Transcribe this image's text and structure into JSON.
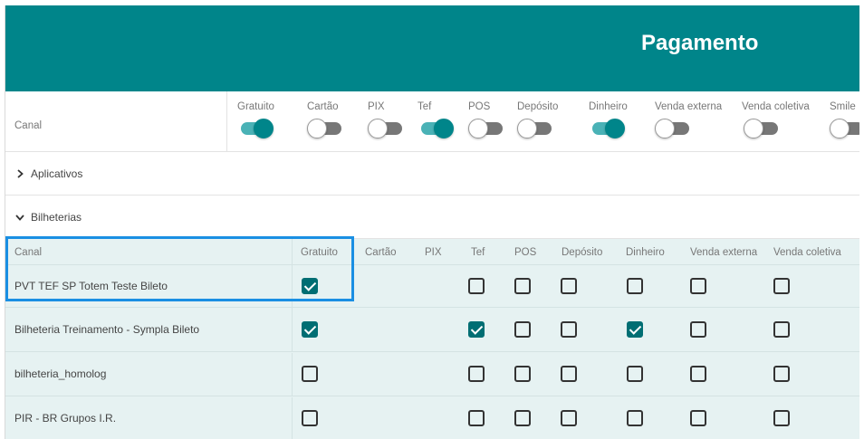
{
  "header": {
    "title": "Pagamento"
  },
  "toggle_header": {
    "canal_label": "Canal",
    "toggles": [
      {
        "label": "Gratuito",
        "on": true
      },
      {
        "label": "Cartão",
        "on": false
      },
      {
        "label": "PIX",
        "on": false
      },
      {
        "label": "Tef",
        "on": true
      },
      {
        "label": "POS",
        "on": false
      },
      {
        "label": "Depósito",
        "on": false
      },
      {
        "label": "Dinheiro",
        "on": true
      },
      {
        "label": "Venda externa",
        "on": false
      },
      {
        "label": "Venda coletiva",
        "on": false
      },
      {
        "label": "Smile",
        "on": false
      }
    ]
  },
  "groups": [
    {
      "label": "Aplicativos",
      "expanded": false,
      "icon": "chevron-right-icon"
    },
    {
      "label": "Bilheterias",
      "expanded": true,
      "icon": "chevron-down-icon"
    }
  ],
  "table": {
    "columns": [
      "Canal",
      "Gratuito",
      "Cartão",
      "PIX",
      "Tef",
      "POS",
      "Depósito",
      "Dinheiro",
      "Venda externa",
      "Venda coletiva"
    ],
    "rows": [
      {
        "name": "PVT TEF SP Totem Teste Bileto",
        "gratuito": true,
        "tef": false,
        "pos": false,
        "deposito": false,
        "dinheiro": false,
        "venda_externa": false,
        "venda_coletiva": false
      },
      {
        "name": "Bilheteria Treinamento - Sympla Bileto",
        "gratuito": true,
        "tef": true,
        "pos": false,
        "deposito": false,
        "dinheiro": true,
        "venda_externa": false,
        "venda_coletiva": false
      },
      {
        "name": "bilheteria_homolog",
        "gratuito": false,
        "tef": false,
        "pos": false,
        "deposito": false,
        "dinheiro": false,
        "venda_externa": false,
        "venda_coletiva": false
      },
      {
        "name": "PIR - BR Grupos I.R.",
        "gratuito": false,
        "tef": false,
        "pos": false,
        "deposito": false,
        "dinheiro": false,
        "venda_externa": false,
        "venda_coletiva": false
      }
    ]
  },
  "colors": {
    "brand": "#00858a",
    "checkbox_checked": "#006e73",
    "highlight": "#1a8fe3",
    "table_bg": "#e6f2f2"
  }
}
